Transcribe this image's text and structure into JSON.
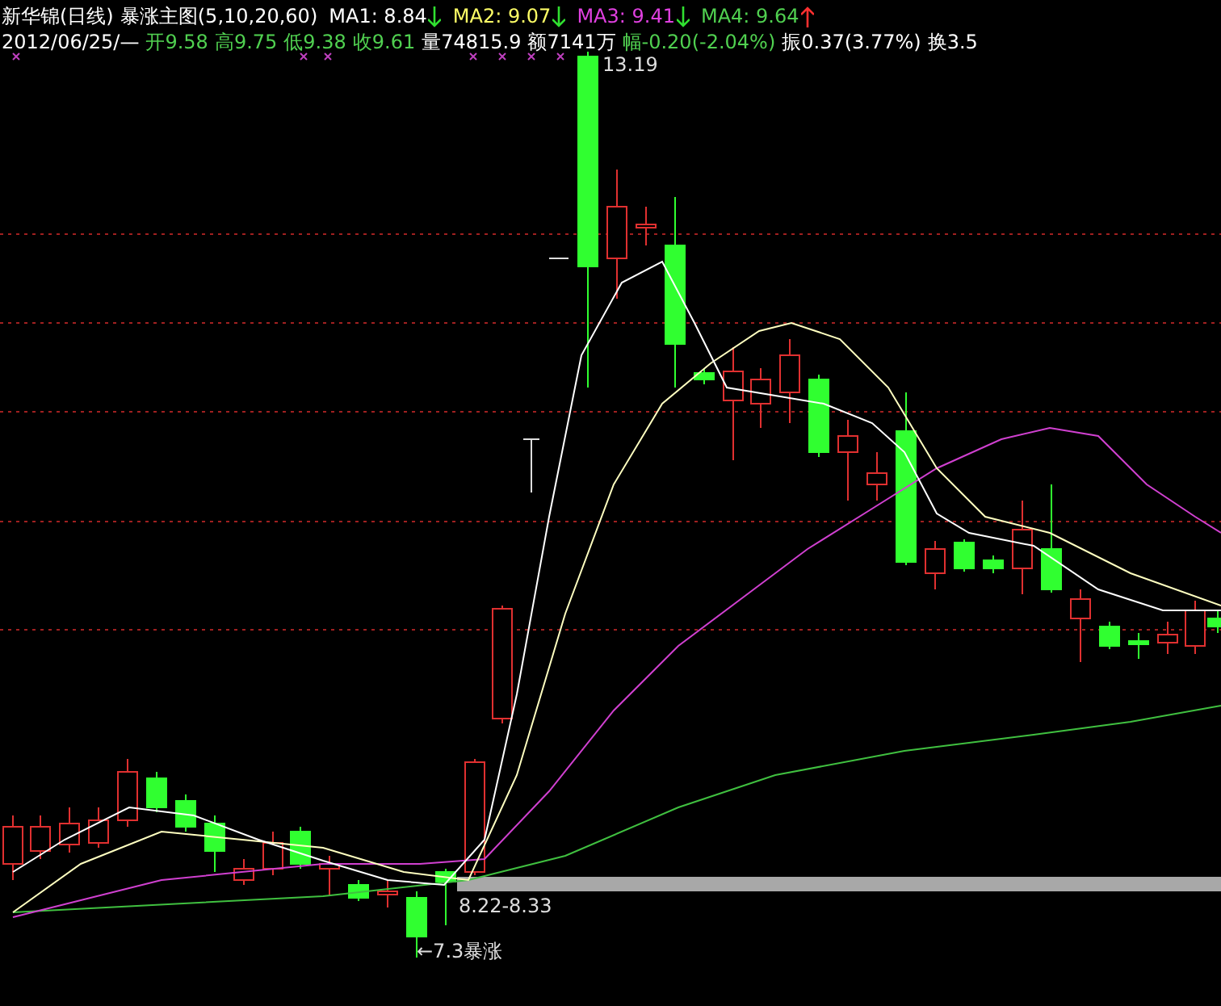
{
  "header": {
    "title": "新华锦(日线)",
    "indicator": "暴涨主图(5,10,20,60)",
    "moving_averages": [
      {
        "label": "MA1:",
        "value": "8.84",
        "rising": false,
        "color": "#ffffff"
      },
      {
        "label": "MA2:",
        "value": "9.07",
        "rising": false,
        "color": "#ffff66"
      },
      {
        "label": "MA3:",
        "value": "9.41",
        "rising": false,
        "color": "#e040e0"
      },
      {
        "label": "MA4:",
        "value": "9.64",
        "rising": true,
        "color": "#50d050"
      }
    ],
    "date": "2012/06/25/—",
    "quote_fields": [
      {
        "text": "开9.58",
        "color": "#50d050"
      },
      {
        "text": "高9.75",
        "color": "#50d050"
      },
      {
        "text": "低9.38",
        "color": "#50d050"
      },
      {
        "text": "收9.61",
        "color": "#50d050"
      },
      {
        "text": "量74815.9",
        "color": "#ffffff"
      },
      {
        "text": "额7141万",
        "color": "#ffffff"
      },
      {
        "text": "幅-0.20(-2.04%)",
        "color": "#50d050"
      },
      {
        "text": "振0.37(3.77%)",
        "color": "#ffffff"
      },
      {
        "text": "换3.5",
        "color": "#ffffff"
      }
    ]
  },
  "chart": {
    "annotations": [
      {
        "kind": "high",
        "text": "13.19"
      },
      {
        "kind": "range",
        "text": "8.22-8.33"
      },
      {
        "kind": "signal",
        "text": "←7.3暴涨"
      }
    ]
  }
}
